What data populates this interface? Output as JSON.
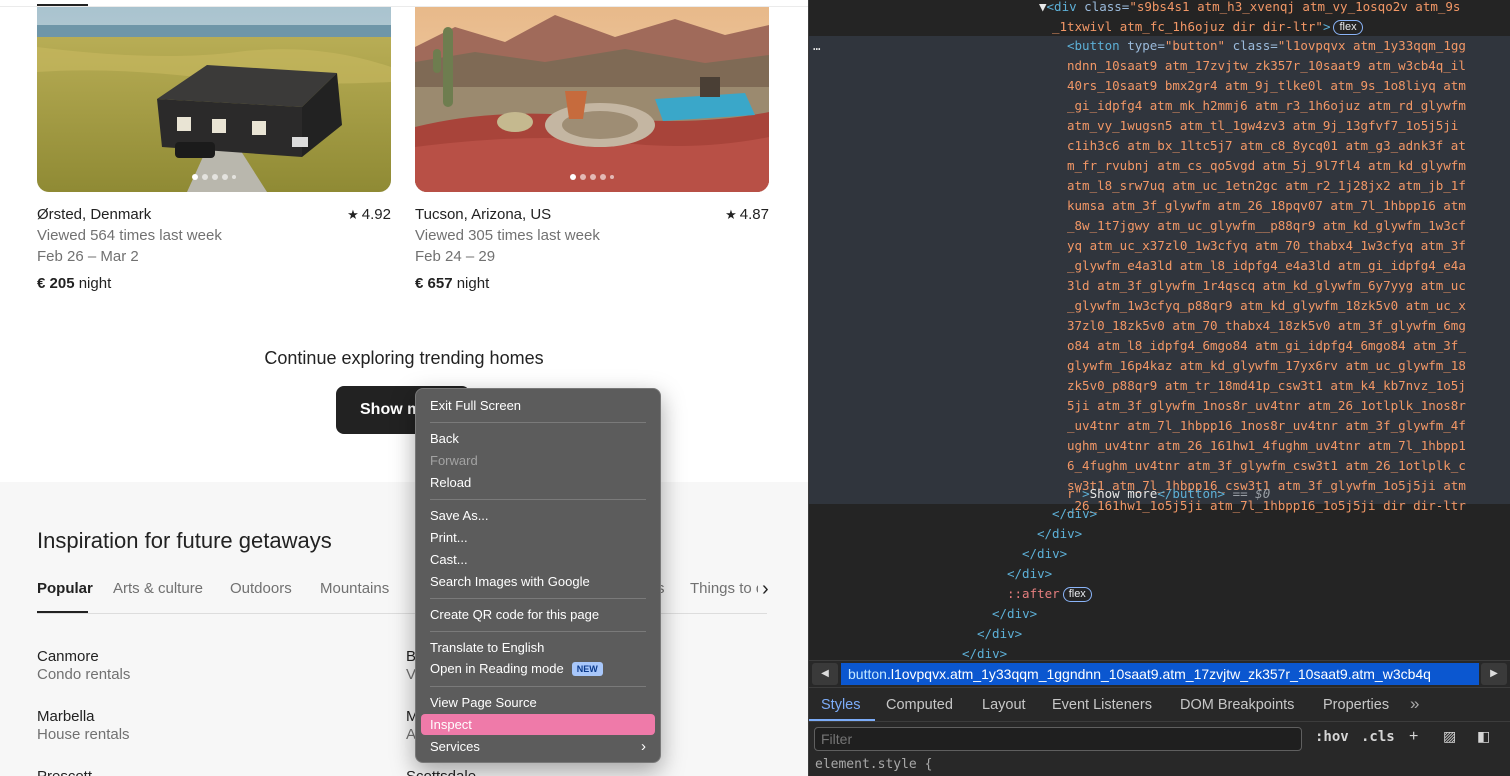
{
  "listings": [
    {
      "title": "Ørsted, Denmark",
      "rating": "4.92",
      "views": "Viewed 564 times last week",
      "dates": "Feb 26 – Mar 2",
      "price": "€ 205",
      "price_unit": "night"
    },
    {
      "title": "Tucson, Arizona, US",
      "rating": "4.87",
      "views": "Viewed 305 times last week",
      "dates": "Feb 24 – 29",
      "price": "€ 657",
      "price_unit": "night"
    }
  ],
  "continue": {
    "heading": "Continue exploring trending homes",
    "button": "Show more"
  },
  "inspiration": {
    "title": "Inspiration for future getaways",
    "tabs": [
      "Popular",
      "Arts & culture",
      "Outdoors",
      "Mountains",
      "s",
      "Things to do"
    ],
    "active_tab": "Popular",
    "cities": [
      {
        "name": "Canmore",
        "type": "Condo rentals"
      },
      {
        "name": "B",
        "type": "V"
      },
      {
        "name": "Marbella",
        "type": "House rentals"
      },
      {
        "name": "M",
        "type": "A"
      },
      {
        "name": "Prescott",
        "type": ""
      },
      {
        "name": "Scottsdale",
        "type": ""
      }
    ]
  },
  "context_menu": {
    "items": [
      {
        "label": "Exit Full Screen"
      },
      {
        "label": "Back"
      },
      {
        "label": "Forward",
        "disabled": true
      },
      {
        "label": "Reload"
      },
      {
        "label": "Save As..."
      },
      {
        "label": "Print..."
      },
      {
        "label": "Cast..."
      },
      {
        "label": "Search Images with Google"
      },
      {
        "label": "Create QR code for this page"
      },
      {
        "label": "Translate to English"
      },
      {
        "label": "Open in Reading mode",
        "badge": "NEW"
      },
      {
        "label": "View Page Source"
      },
      {
        "label": "Inspect",
        "highlighted": true
      },
      {
        "label": "Services",
        "submenu": true
      }
    ],
    "highlight_color": "#ef7aa9"
  },
  "devtools": {
    "dom": {
      "div_class_1": "s9bs4s1 atm_h3_xvenqj atm_vy_1osqo2v atm_9s",
      "div_class_2": "_1txwivl atm_fc_1h6ojuz dir dir-ltr",
      "flex_badge": "flex",
      "ellipsis": "…",
      "button_class_lines": [
        "l1ovpqvx atm_1y33qqm_1gg",
        "ndnn_10saat9 atm_17zvjtw_zk357r_10saat9 atm_w3cb4q_il",
        "40rs_10saat9 bmx2gr4 atm_9j_tlke0l atm_9s_1o8liyq atm",
        "_gi_idpfg4 atm_mk_h2mmj6 atm_r3_1h6ojuz atm_rd_glywfm",
        "atm_vy_1wugsn5 atm_tl_1gw4zv3 atm_9j_13gfvf7_1o5j5ji",
        "c1ih3c6 atm_bx_1ltc5j7 atm_c8_8ycq01 atm_g3_adnk3f at",
        "m_fr_rvubnj atm_cs_qo5vgd atm_5j_9l7fl4 atm_kd_glywfm",
        "atm_l8_srw7uq atm_uc_1etn2gc atm_r2_1j28jx2 atm_jb_1f",
        "kumsa atm_3f_glywfm atm_26_18pqv07 atm_7l_1hbpp16 atm",
        "_8w_1t7jgwy atm_uc_glywfm__p88qr9 atm_kd_glywfm_1w3cf",
        "yq atm_uc_x37zl0_1w3cfyq atm_70_thabx4_1w3cfyq atm_3f",
        "_glywfm_e4a3ld atm_l8_idpfg4_e4a3ld atm_gi_idpfg4_e4a",
        "3ld atm_3f_glywfm_1r4qscq atm_kd_glywfm_6y7yyg atm_uc",
        "_glywfm_1w3cfyq_p88qr9 atm_kd_glywfm_18zk5v0 atm_uc_x",
        "37zl0_18zk5v0 atm_70_thabx4_18zk5v0 atm_3f_glywfm_6mg",
        "o84 atm_l8_idpfg4_6mgo84 atm_gi_idpfg4_6mgo84 atm_3f_",
        "glywfm_16p4kaz atm_kd_glywfm_17yx6rv atm_uc_glywfm_18",
        "zk5v0_p88qr9 atm_tr_18md41p_csw3t1 atm_k4_kb7nvz_1o5j",
        "5ji atm_3f_glywfm_1nos8r_uv4tnr atm_26_1otlplk_1nos8r",
        "_uv4tnr atm_7l_1hbpp16_1nos8r_uv4tnr atm_3f_glywfm_4f",
        "ughm_uv4tnr atm_26_161hw1_4fughm_uv4tnr atm_7l_1hbpp1",
        "6_4fughm_uv4tnr atm_3f_glywfm_csw3t1 atm_26_1otlplk_c",
        "sw3t1 atm_7l_1hbpp16_csw3t1 atm_3f_glywfm_1o5j5ji atm",
        "_26_161hw1_1o5j5ji atm_7l_1hbpp16_1o5j5ji dir dir-ltr"
      ],
      "button_class_tail": "r",
      "button_text": "Show more",
      "dollar_zero": "== $0",
      "after": "::after"
    },
    "breadcrumb": {
      "tag": "button",
      "classes": ".l1ovpqvx.atm_1y33qqm_1ggndnn_10saat9.atm_17zvjtw_zk357r_10saat9.atm_w3cb4q"
    },
    "tabs": [
      "Styles",
      "Computed",
      "Layout",
      "Event Listeners",
      "DOM Breakpoints",
      "Properties"
    ],
    "active_tab": "Styles",
    "filter_placeholder": "Filter",
    "hov": ":hov",
    "cls": ".cls",
    "style_rule": "element.style {"
  },
  "colors": {
    "devtools_bg": "#282828",
    "attr_value": "#f29766",
    "tag": "#5db0d7",
    "selection_bg": "#30353d",
    "crumb_bg": "#0b57d0"
  }
}
